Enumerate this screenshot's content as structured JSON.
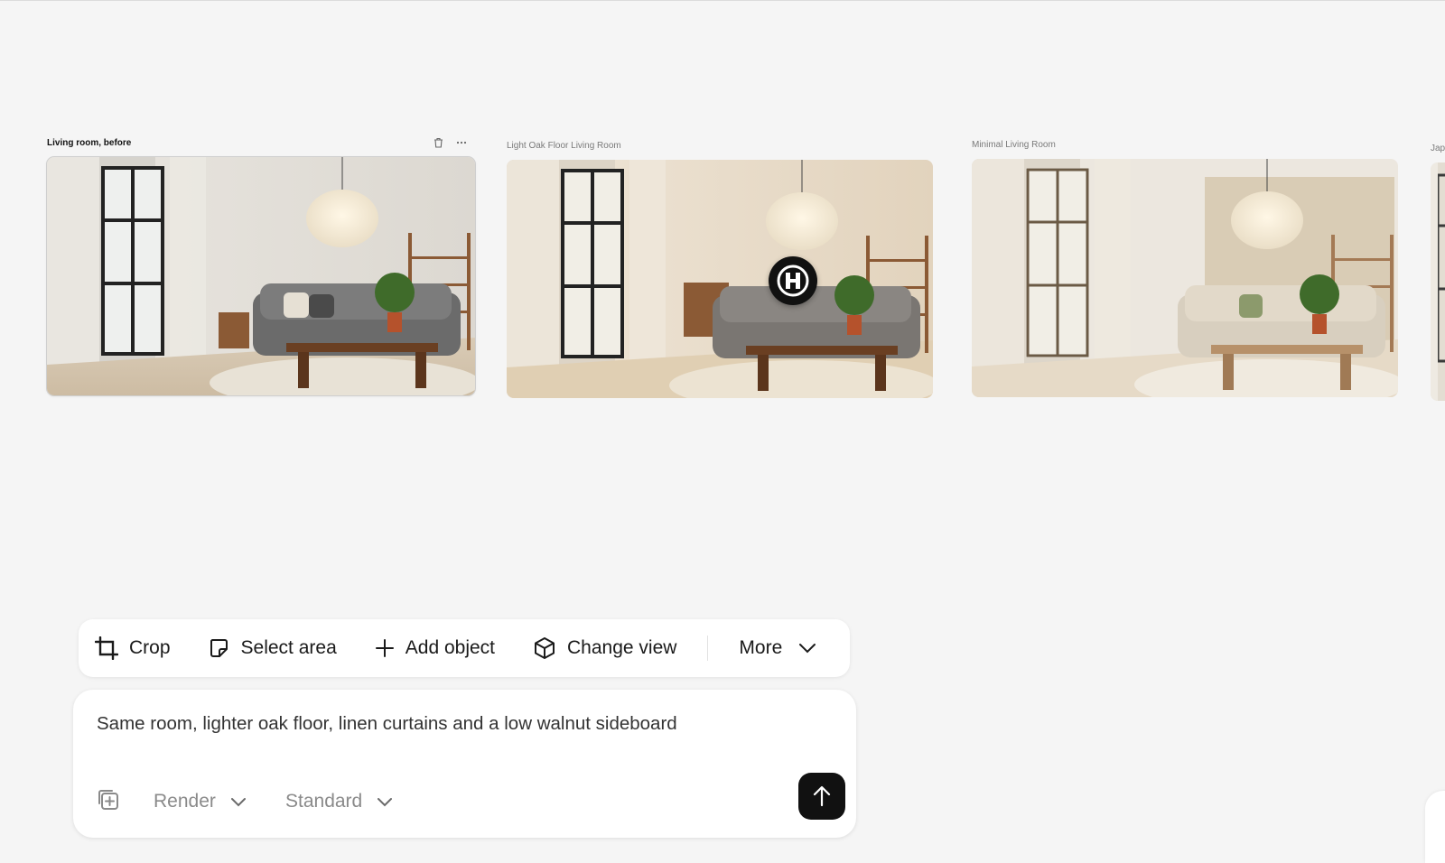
{
  "canvas": {
    "cards": [
      {
        "title": "Living room, before",
        "selected": true
      },
      {
        "title": "Light Oak Floor Living Room",
        "selected": false
      },
      {
        "title": "Minimal Living Room",
        "selected": false
      },
      {
        "title": "Jap",
        "selected": false
      }
    ],
    "card_actions": {
      "delete_icon": "trash-icon",
      "more_icon": "ellipsis-icon"
    }
  },
  "toolbar": {
    "crop": "Crop",
    "select_area": "Select area",
    "add_object": "Add object",
    "change_view": "Change view",
    "more": "More"
  },
  "prompt": {
    "text": "Same room, lighter oak floor, linen curtains and a low walnut sideboard",
    "mode": "Render",
    "quality": "Standard",
    "send_icon": "arrow-up-icon"
  },
  "colors": {
    "background": "#f5f5f5",
    "panel": "#ffffff",
    "send_button": "#111111"
  }
}
